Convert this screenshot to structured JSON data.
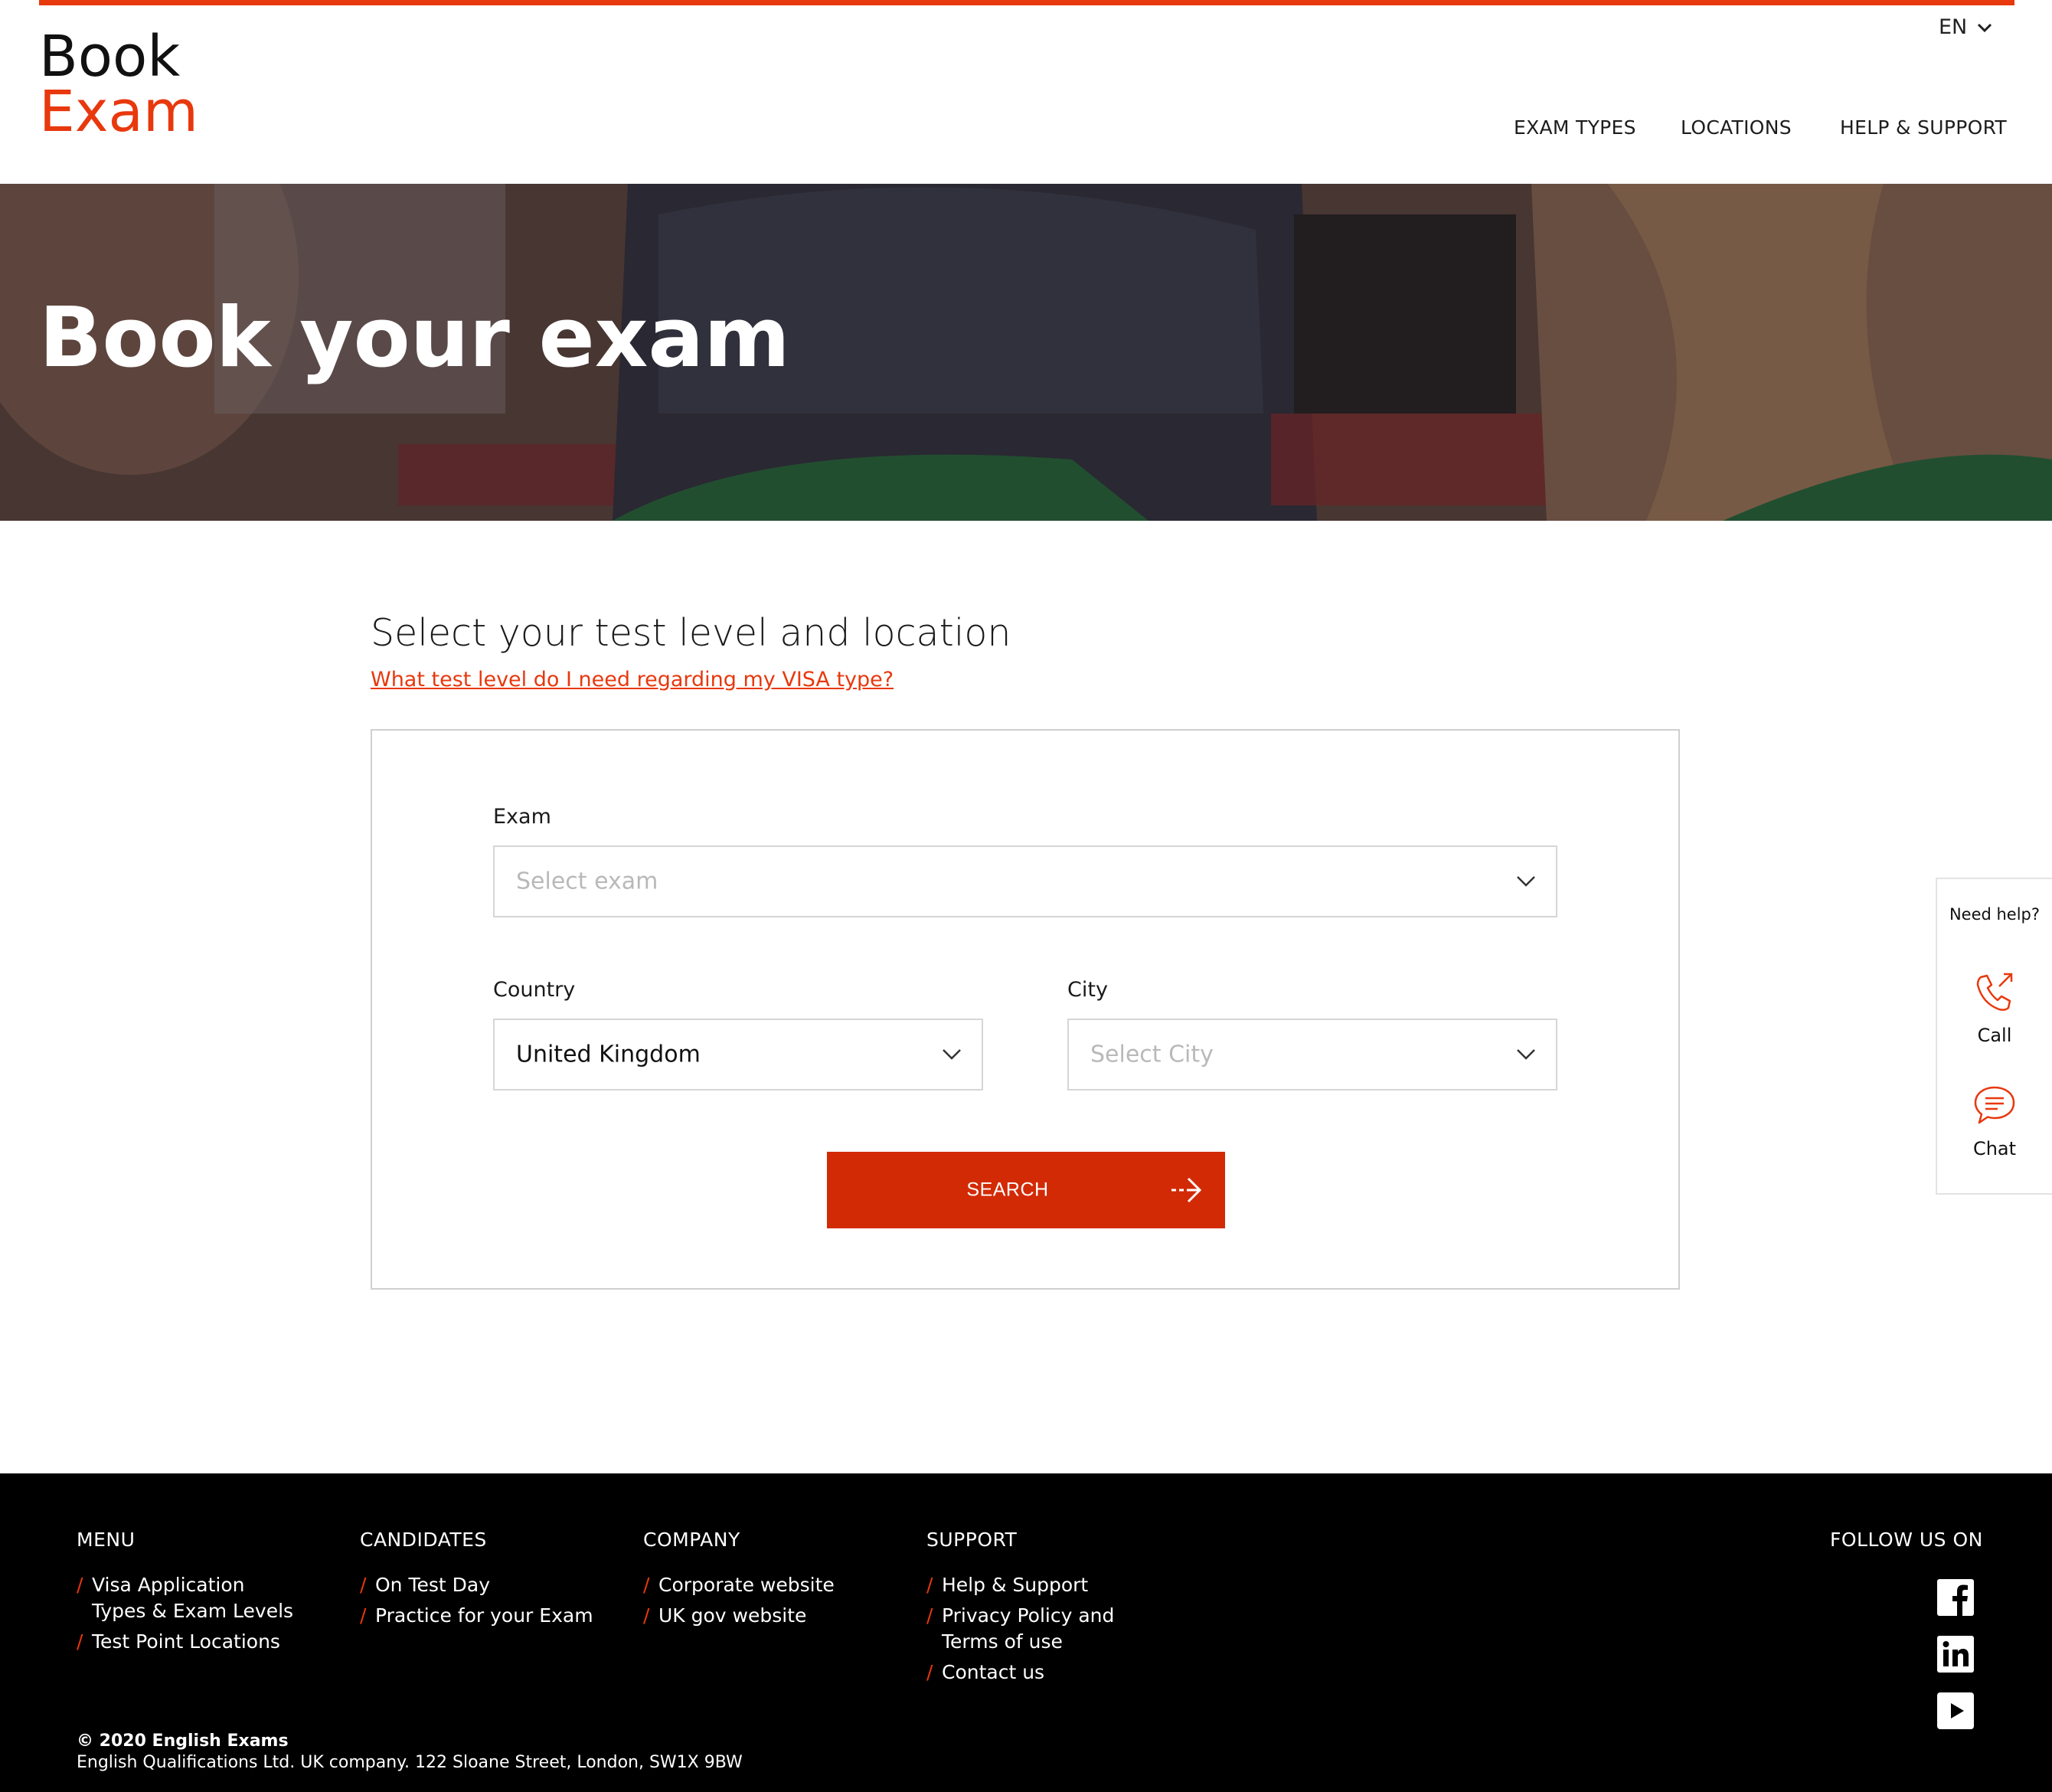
{
  "brand": {
    "line1": "Book",
    "line2": "Exam",
    "accent": "#e8380d"
  },
  "language": "EN",
  "nav": [
    "EXAM TYPES",
    "LOCATIONS",
    "HELP & SUPPORT"
  ],
  "hero": {
    "title": "Book your exam"
  },
  "main": {
    "title": "Select your test level and location",
    "visa_link": "What test level do I need regarding my VISA type?",
    "form": {
      "exam_label": "Exam",
      "exam_placeholder": "Select exam",
      "country_label": "Country",
      "country_value": "United Kingdom",
      "city_label": "City",
      "city_placeholder": "Select City",
      "search_label": "SEARCH"
    }
  },
  "help_widget": {
    "title": "Need help?",
    "call": "Call",
    "chat": "Chat"
  },
  "footer": {
    "menu": {
      "title": "MENU",
      "items": [
        [
          "Visa Application",
          "Types & Exam Levels"
        ],
        [
          "Test Point Locations"
        ]
      ]
    },
    "candidates": {
      "title": "CANDIDATES",
      "items": [
        [
          "On Test Day"
        ],
        [
          "Practice for your Exam"
        ]
      ]
    },
    "company": {
      "title": "COMPANY",
      "items": [
        [
          "Corporate website"
        ],
        [
          "UK gov website"
        ]
      ]
    },
    "support": {
      "title": "SUPPORT",
      "items": [
        [
          "Help & Support"
        ],
        [
          "Privacy Policy and",
          "Terms of use"
        ],
        [
          "Contact us"
        ]
      ]
    },
    "follow": "FOLLOW US ON",
    "social": [
      "facebook-icon",
      "linkedin-icon",
      "youtube-icon"
    ],
    "copyright": "© 2020 English Exams",
    "address": "English Qualifications Ltd. UK company. 122 Sloane Street, London, SW1X 9BW"
  }
}
